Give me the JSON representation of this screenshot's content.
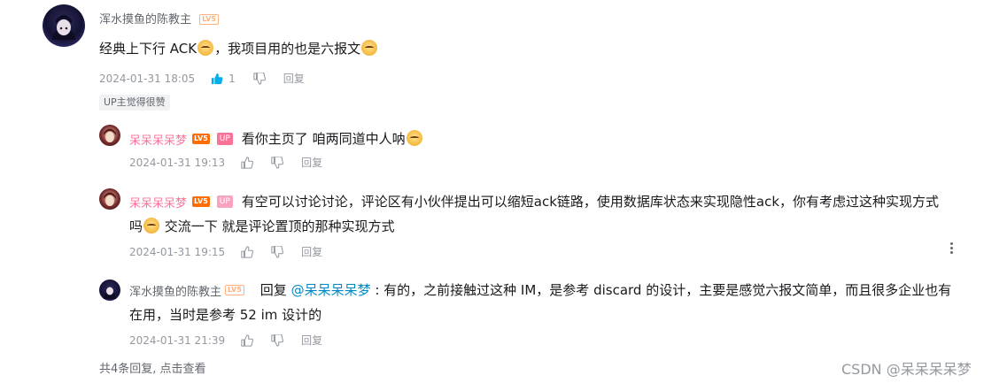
{
  "root_comment": {
    "username": "浑水摸鱼的陈教主",
    "level": "LV5",
    "text_part1": "经典上下行 ACK",
    "text_part2": "，我项目用的也是六报文",
    "time": "2024-01-31 18:05",
    "like_count": "1",
    "reply_label": "回复",
    "badge": "UP主觉得很赞"
  },
  "replies": [
    {
      "username": "呆呆呆呆梦",
      "level": "LV5",
      "up_tag": "UP",
      "text": "看你主页了 咱两同道中人呐",
      "time": "2024-01-31 19:13",
      "reply_label": "回复"
    },
    {
      "username": "呆呆呆呆梦",
      "level": "LV5",
      "up_tag": "UP",
      "text_line1": "有空可以讨论讨论，评论区有小伙伴提出可以缩短ack链路，使用数据库状态来实现隐性ack，你有考虑过这种实现方式",
      "text_line2a": "吗",
      "text_line2b": " 交流一下 就是评论置顶的那种实现方式",
      "time": "2024-01-31 19:15",
      "reply_label": "回复"
    },
    {
      "username": "浑水摸鱼的陈教主",
      "level": "LV5",
      "reply_prefix": "回复 ",
      "mention": "@呆呆呆呆梦",
      "text_line1": " : 有的，之前接触过这种 IM，是参考 discard 的设计，主要是感觉六报文简单，而且很多企业也有",
      "text_line2": "在用，当时是参考 52 im 设计的",
      "time": "2024-01-31 21:39",
      "reply_label": "回复"
    }
  ],
  "footer": {
    "summary": "共4条回复, 点击查看"
  },
  "watermark": "CSDN @呆呆呆呆梦"
}
